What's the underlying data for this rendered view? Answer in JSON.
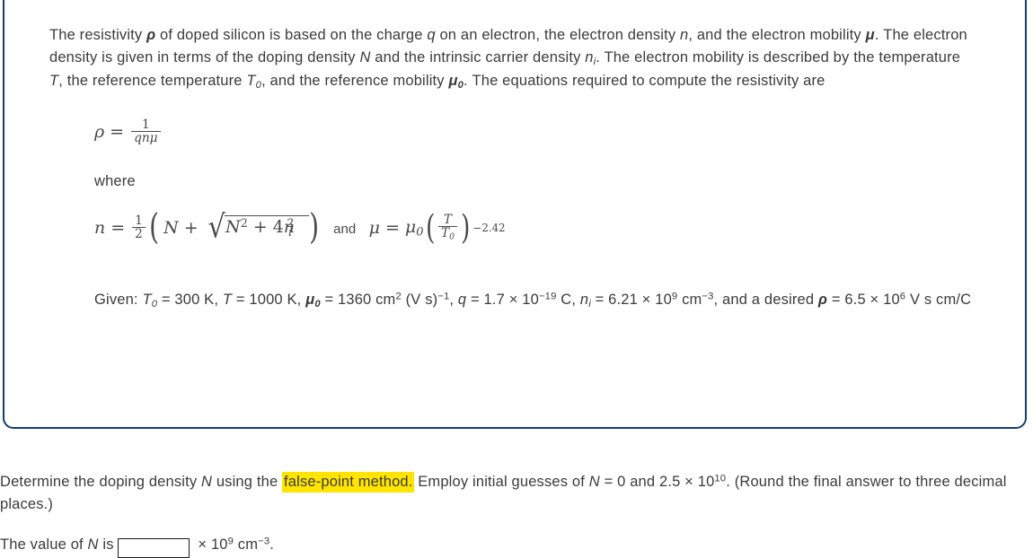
{
  "card": {
    "border_color": "#123f6d",
    "paragraph": {
      "s1": "The resistivity ",
      "sym_rho": "ρ",
      "s2": " of doped silicon is based on the charge ",
      "sym_q": "q",
      "s3": " on an electron, the electron density ",
      "sym_n": "n",
      "s4": ", and the electron mobility ",
      "sym_mu": "μ",
      "s5": ". The electron density is given in terms of the doping density ",
      "sym_N": "N",
      "s6": " and the intrinsic carrier density ",
      "sym_ni_base": "n",
      "sym_ni_sub": "i",
      "s7": ". The electron mobility is described by the temperature ",
      "sym_T": "T",
      "s8": ", the reference temperature ",
      "sym_T0_base": "T",
      "sym_T0_sub": "0",
      "s9": ", and the reference mobility ",
      "sym_mu0_base": "μ",
      "sym_mu0_sub": "0",
      "s10": ". The equations required to compute the resistivity are"
    },
    "equation1": {
      "lhs": "ρ",
      "eq": "=",
      "numerator": "1",
      "denominator": "qnμ"
    },
    "where_label": "where",
    "equation2": {
      "lhs": "n",
      "eq": "=",
      "half_num": "1",
      "half_den": "2",
      "open_paren": "(",
      "inner_N": "N",
      "plus": "+",
      "radical": "√",
      "radicand_N": "N",
      "radicand_N_sup": "2",
      "radicand_plus": "+",
      "radicand_4": "4",
      "radicand_n": "n",
      "radicand_n_sub": "i",
      "radicand_n_sup": "2",
      "close_paren": ")",
      "and_word": "and",
      "mu_lhs": "μ",
      "mu_eq": "=",
      "mu0_base": "μ",
      "mu0_sub": "0",
      "ratio_num": "T",
      "ratio_den_base": "T",
      "ratio_den_sub": "0",
      "exponent": "−2.42"
    },
    "given": {
      "label": "Given: ",
      "T0_sym": "T",
      "T0_sub": "0",
      "T0_val": " = 300 K, ",
      "T_sym": "T",
      "T_val": " = 1000 K, ",
      "mu0_sym": "μ",
      "mu0_sub": "0",
      "mu0_val_a": " = 1360 cm",
      "mu0_val_sup": "2",
      "mu0_val_b": " (V s)",
      "mu0_val_sup2": "−1",
      "mu0_val_c": ", ",
      "q_sym": "q",
      "q_val_a": " = 1.7 × 10",
      "q_val_sup": "−19",
      "q_val_b": " C, ",
      "ni_sym": "n",
      "ni_sub": "i",
      "ni_val_a": " = 6.21 × 10",
      "ni_val_sup": "9",
      "ni_val_b": " cm",
      "ni_val_sup2": "−3",
      "ni_val_c": ", and a desired ",
      "rho_sym": "ρ",
      "rho_val_a": " = 6.5 × 10",
      "rho_val_sup": "6",
      "rho_val_b": " V s cm/C"
    }
  },
  "question": {
    "t1": "Determine the doping density ",
    "sym_N": "N",
    "t2": " using the ",
    "highlighted": "false-point method.",
    "t3": " Employ initial guesses of ",
    "sym_N2": "N",
    "t4": " = 0 and 2.5 × 10",
    "sup": "10",
    "t5": ". (Round the final answer to three decimal places.)",
    "highlight_color": "#ffe400"
  },
  "answer": {
    "prefix": "The value of ",
    "sym_N": "N",
    "prefix2": " is",
    "input_value": "",
    "input_placeholder": "",
    "suffix_a": " × 10",
    "suffix_sup": "9",
    "suffix_b": " cm",
    "suffix_sup2": "−3",
    "suffix_c": "."
  }
}
